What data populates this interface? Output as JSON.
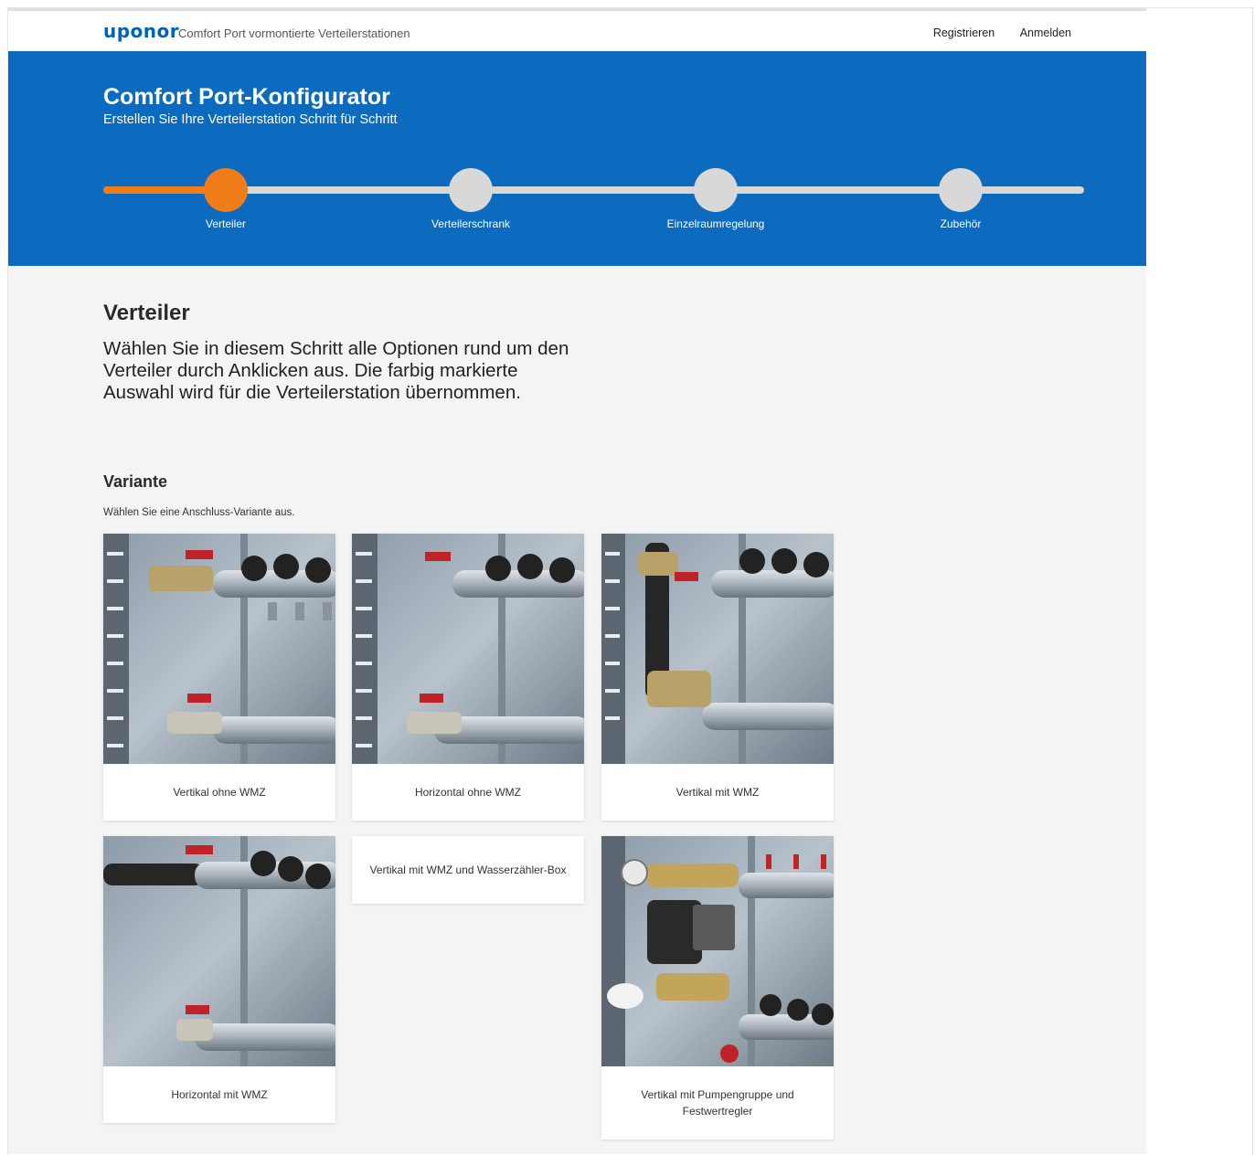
{
  "header": {
    "logo": "uponor",
    "tagline": "Comfort Port vormontierte Verteilerstationen",
    "nav": [
      "Registrieren",
      "Anmelden"
    ]
  },
  "hero": {
    "title": "Comfort Port-Konfigurator",
    "subtitle": "Erstellen Sie Ihre Verteilerstation Schritt für Schritt",
    "steps": [
      {
        "label": "Verteiler",
        "active": true
      },
      {
        "label": "Verteilerschrank",
        "active": false
      },
      {
        "label": "Einzelraumregelung",
        "active": false
      },
      {
        "label": "Zubehör",
        "active": false
      }
    ],
    "progress_percent": 12.5
  },
  "content": {
    "step_title": "Verteiler",
    "intro": "Wählen Sie in diesem Schritt alle Optionen rund um den Verteiler durch Anklicken aus. Die farbig markierte Auswahl wird für die Verteilerstation übernommen.",
    "variant_title": "Variante",
    "variant_hint": "Wählen Sie eine Anschluss-Variante aus.",
    "variants": [
      {
        "label": "Vertikal ohne WMZ",
        "has_image": true
      },
      {
        "label": "Horizontal ohne WMZ",
        "has_image": true
      },
      {
        "label": "Vertikal mit WMZ",
        "has_image": true
      },
      {
        "label": "Horizontal mit WMZ",
        "has_image": true
      },
      {
        "label": "Vertikal mit WMZ und Wasserzähler-Box",
        "has_image": false
      },
      {
        "label": "Vertikal mit Pumpengruppe und Festwertregler",
        "has_image": true
      }
    ]
  },
  "colors": {
    "brand_blue": "#0c6bbf",
    "accent_orange": "#f07d1a",
    "track_grey": "#d8d8d8",
    "page_bg": "#f4f4f4"
  }
}
